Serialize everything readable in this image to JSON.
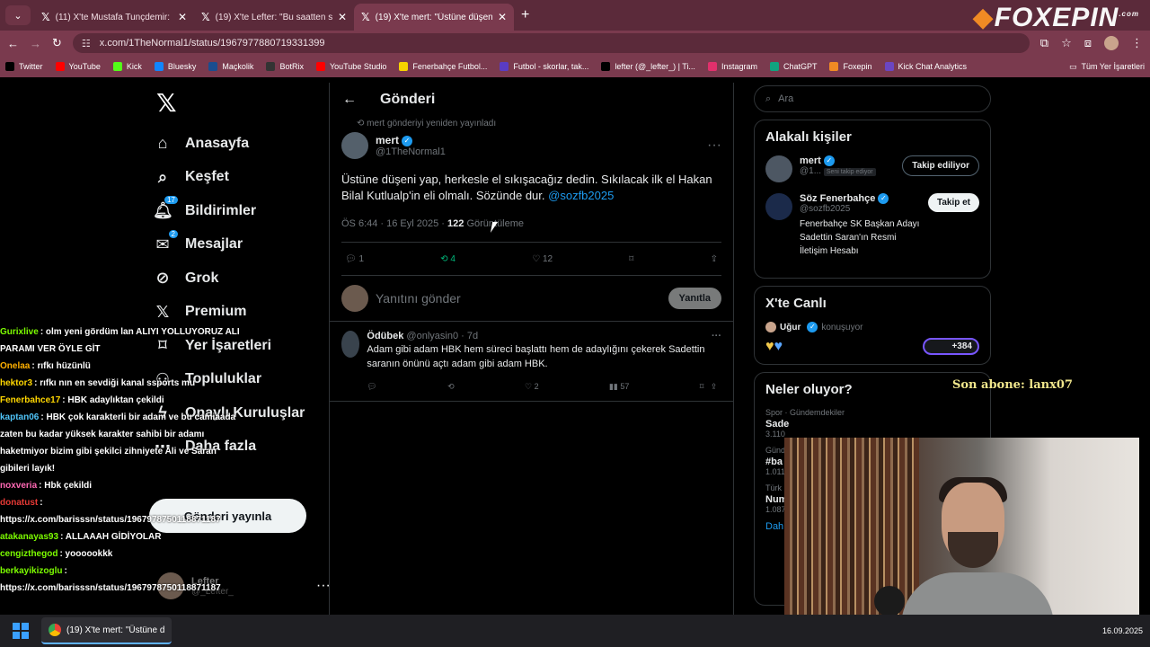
{
  "browser": {
    "tabs": [
      {
        "title": "(11) X'te Mustafa Tunçdemir: \"\"",
        "active": false
      },
      {
        "title": "(19) X'te Lefter: \"Bu saatten son\"",
        "active": false
      },
      {
        "title": "(19) X'te mert: \"Üstüne düşeni y\"",
        "active": true
      }
    ],
    "url": "x.com/1TheNormal1/status/1967977880719331399",
    "bookmarks": [
      "Twitter",
      "YouTube",
      "Kick",
      "Bluesky",
      "Maçkolik",
      "BotRix",
      "YouTube Studio",
      "Fenerbahçe Futbol...",
      "Futbol - skorlar, tak...",
      "lefter (@_lefter_) | Ti...",
      "Instagram",
      "ChatGPT",
      "Foxepin",
      "Kick Chat Analytics"
    ],
    "all_bookmarks": "Tüm Yer İşaretleri"
  },
  "overlay": {
    "brand": "FOXEPIN",
    "brand_sub": ".com",
    "son_abone": "Son abone: lanx07"
  },
  "nav": {
    "items": [
      {
        "label": "Anasayfa",
        "icon": "home-icon"
      },
      {
        "label": "Keşfet",
        "icon": "search-icon"
      },
      {
        "label": "Bildirimler",
        "icon": "bell-icon",
        "badge": "17"
      },
      {
        "label": "Mesajlar",
        "icon": "mail-icon",
        "badge": "2"
      },
      {
        "label": "Grok",
        "icon": "grok-icon"
      },
      {
        "label": "Premium",
        "icon": "x-icon"
      },
      {
        "label": "Yer İşaretleri",
        "icon": "bookmark-icon"
      },
      {
        "label": "Topluluklar",
        "icon": "people-icon"
      },
      {
        "label": "Onaylı Kuruluşlar",
        "icon": "lightning-icon"
      },
      {
        "label": "Daha fazla",
        "icon": "more-icon"
      }
    ],
    "post_button": "Gönderi yayınla",
    "profile_name": "Lefter",
    "profile_handle": "@_Lefter_"
  },
  "chat": [
    {
      "user": "Gurixlive",
      "color": "#7cfc00",
      "text": ": olm yeni gördüm lan ALIYI YOLLUYORUZ ALI PARAMI VER ÖYLE GİT"
    },
    {
      "user": "Onelaa",
      "color": "#ffb000",
      "text": ": rıfkı hüzünlü"
    },
    {
      "user": "hektor3",
      "color": "#ffd700",
      "text": ": rıfkı nın en sevdiği kanal ssports mu"
    },
    {
      "user": "Fenerbahce17",
      "color": "#ffd700",
      "text": ": HBK adaylıktan çekildi"
    },
    {
      "user": "kaptan06",
      "color": "#4fc3f7",
      "text": ": HBK çok karakterli bir adam ve bu camiaada zaten bu kadar yüksek karakter sahibi bir adamı haketmiyor bizim gibi şekilci zihniyete Ali ve Saran gibileri layık!"
    },
    {
      "user": "noxveria",
      "color": "#ff69b4",
      "text": ": Hbk çekildi"
    },
    {
      "user": "donatust",
      "color": "#e53935",
      "text": ": https://x.com/barisssn/status/1967978750118871187"
    },
    {
      "user": "atakanayas93",
      "color": "#7cfc00",
      "text": ": ALLAAAH GİDİYOLAR"
    },
    {
      "user": "cengizthegod",
      "color": "#7cfc00",
      "text": ": yoooookkk"
    },
    {
      "user": "berkayikizoglu",
      "color": "#7cfc00",
      "text": ": https://x.com/barisssn/status/1967978750118871187"
    }
  ],
  "main": {
    "title": "Gönderi",
    "repost_context": "mert gönderiyi yeniden yayınladı",
    "tweet": {
      "name": "mert",
      "handle": "@1TheNormal1",
      "text": "Üstüne düşeni yap, herkesle el sıkışacağız dedin. Sıkılacak ilk el Hakan Bilal Kutlualp'in eli olmalı. Sözünde dur.",
      "mention": "@sozfb2025",
      "time": "ÖS 6:44 · 16 Eyl 2025 · ",
      "views": "122",
      "views_label": "Görüntüleme",
      "replies": "1",
      "reposts": "4",
      "likes": "12"
    },
    "reply_placeholder": "Yanıtını gönder",
    "reply_button": "Yanıtla",
    "reply": {
      "name": "Ödübek",
      "handle": "@onlyasin0 · 7d",
      "text": "Adam gibi adam HBK hem süreci başlattı hem de adaylığını çekerek Sadettin saranın önünü açtı adam gibi adam HBK.",
      "likes": "2",
      "views": "57"
    }
  },
  "side": {
    "search_placeholder": "Ara",
    "related_title": "Alakalı kişiler",
    "people": [
      {
        "name": "mert",
        "handle": "@1...",
        "follows_you": "Seni takip ediyor",
        "button": "Takip ediliyor"
      },
      {
        "name": "Söz Fenerbahçe",
        "handle": "@sozfb2025",
        "bio": "Fenerbahçe SK Başkan Adayı Sadettin Saran'ın Resmi İletişim Hesabı",
        "button": "Takip et"
      }
    ],
    "live_title": "X'te Canlı",
    "live_host": "Uğur",
    "live_status": "konuşuyor",
    "live_count": "+384",
    "trends_title": "Neler oluyor?",
    "trends": [
      {
        "meta": "Spor · Gündemdekiler",
        "name": "Sade",
        "count": "3.110"
      },
      {
        "meta": "Günd",
        "name": "#ba",
        "count": "1.011"
      },
      {
        "meta": "Türk",
        "name": "Num",
        "count": "1.087"
      }
    ],
    "show_more": "Dah"
  },
  "taskbar": {
    "app_title": "(19) X'te mert: \"Üstüne d",
    "date": "16.09.2025"
  }
}
